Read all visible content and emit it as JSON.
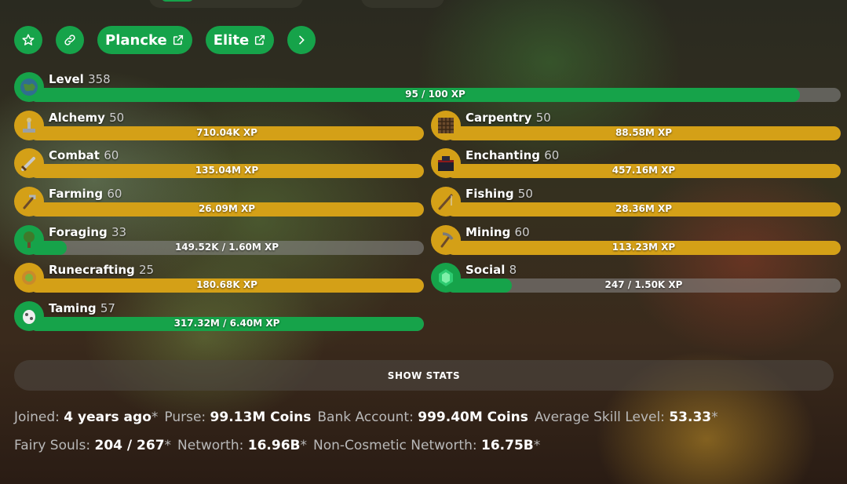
{
  "colors": {
    "green": "#16a34a",
    "gold": "#d4a017",
    "track": "#8c8c8c"
  },
  "actions": {
    "profile_label": "Plancke",
    "elite_label": "Elite"
  },
  "level": {
    "name": "Level",
    "level": "358",
    "progress_text": "95 / 100 XP",
    "progress": 0.95
  },
  "skills": [
    {
      "name": "Alchemy",
      "level": "50",
      "progress_text": "710.04K XP",
      "maxed": true,
      "progress": 1.0
    },
    {
      "name": "Carpentry",
      "level": "50",
      "progress_text": "88.58M XP",
      "maxed": true,
      "progress": 1.0
    },
    {
      "name": "Combat",
      "level": "60",
      "progress_text": "135.04M XP",
      "maxed": true,
      "progress": 1.0
    },
    {
      "name": "Enchanting",
      "level": "60",
      "progress_text": "457.16M XP",
      "maxed": true,
      "progress": 1.0
    },
    {
      "name": "Farming",
      "level": "60",
      "progress_text": "26.09M XP",
      "maxed": true,
      "progress": 1.0
    },
    {
      "name": "Fishing",
      "level": "50",
      "progress_text": "28.36M XP",
      "maxed": true,
      "progress": 1.0
    },
    {
      "name": "Foraging",
      "level": "33",
      "progress_text": "149.52K / 1.60M XP",
      "maxed": false,
      "progress": 0.093
    },
    {
      "name": "Mining",
      "level": "60",
      "progress_text": "113.23M XP",
      "maxed": true,
      "progress": 1.0
    },
    {
      "name": "Runecrafting",
      "level": "25",
      "progress_text": "180.68K XP",
      "maxed": true,
      "progress": 1.0
    },
    {
      "name": "Social",
      "level": "8",
      "progress_text": "247 / 1.50K XP",
      "maxed": false,
      "progress": 0.165
    },
    {
      "name": "Taming",
      "level": "57",
      "progress_text": "317.32M / 6.40M XP",
      "maxed": false,
      "progress": 1.0
    }
  ],
  "show_stats_label": "SHOW STATS",
  "stats_line1": [
    {
      "key": "Joined:",
      "value": "4 years ago",
      "asterisk": "*"
    },
    {
      "key": "Purse:",
      "value": "99.13M Coins",
      "asterisk": ""
    },
    {
      "key": "Bank Account:",
      "value": "999.40M Coins",
      "asterisk": ""
    },
    {
      "key": "Average Skill Level:",
      "value": "53.33",
      "asterisk": "*"
    }
  ],
  "stats_line2": [
    {
      "key": "Fairy Souls:",
      "value": "204 / 267",
      "asterisk": "*"
    },
    {
      "key": "Networth:",
      "value": "16.96B",
      "asterisk": "*"
    },
    {
      "key": "Non-Cosmetic Networth:",
      "value": "16.75B",
      "asterisk": "*"
    }
  ]
}
